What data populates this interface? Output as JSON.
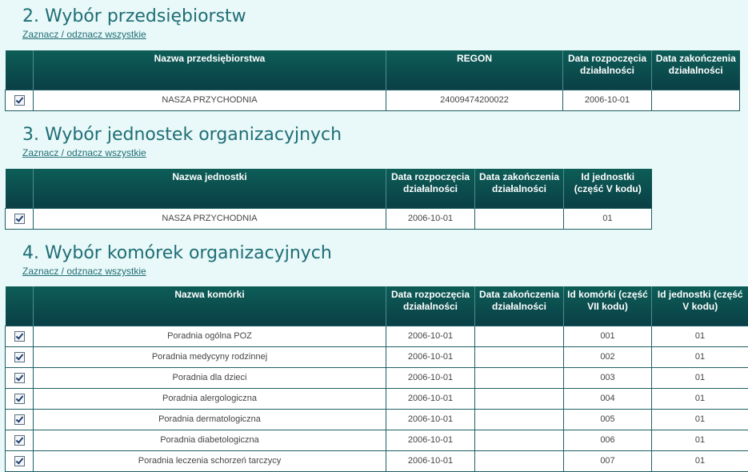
{
  "toggle_label": "Zaznacz / odznacz wszystkie",
  "sections": [
    {
      "title": "2. Wybór przedsiębiorstw",
      "headers": [
        "Nazwa przedsiębiorstwa",
        "REGON",
        "Data rozpoczęcia działalności",
        "Data zakończenia działalności"
      ],
      "rows": [
        {
          "checked": true,
          "cells": [
            "NASZA PRZYCHODNIA",
            "24009474200022",
            "2006-10-01",
            ""
          ]
        }
      ]
    },
    {
      "title": "3. Wybór jednostek organizacyjnych",
      "headers": [
        "Nazwa jednostki",
        "Data rozpoczęcia działalności",
        "Data zakończenia działalności",
        "Id jednostki (część V kodu)"
      ],
      "rows": [
        {
          "checked": true,
          "cells": [
            "NASZA PRZYCHODNIA",
            "2006-10-01",
            "",
            "01"
          ]
        }
      ]
    },
    {
      "title": "4. Wybór komórek organizacyjnych",
      "headers": [
        "Nazwa komórki",
        "Data rozpoczęcia działalności",
        "Data zakończenia działalności",
        "Id komórki (część VII kodu)",
        "Id jednostki (część V kodu)"
      ],
      "rows": [
        {
          "checked": true,
          "cells": [
            "Poradnia ogólna POZ",
            "2006-10-01",
            "",
            "001",
            "01"
          ]
        },
        {
          "checked": true,
          "cells": [
            "Poradnia medycyny rodzinnej",
            "2006-10-01",
            "",
            "002",
            "01"
          ]
        },
        {
          "checked": true,
          "cells": [
            "Poradnia dla dzieci",
            "2006-10-01",
            "",
            "003",
            "01"
          ]
        },
        {
          "checked": true,
          "cells": [
            "Poradnia alergologiczna",
            "2006-10-01",
            "",
            "004",
            "01"
          ]
        },
        {
          "checked": true,
          "cells": [
            "Poradnia dermatologiczna",
            "2006-10-01",
            "",
            "005",
            "01"
          ]
        },
        {
          "checked": true,
          "cells": [
            "Poradnia diabetologiczna",
            "2006-10-01",
            "",
            "006",
            "01"
          ]
        },
        {
          "checked": true,
          "cells": [
            "Poradnia leczenia schorzeń tarczycy",
            "2006-10-01",
            "",
            "007",
            "01"
          ]
        }
      ]
    }
  ]
}
